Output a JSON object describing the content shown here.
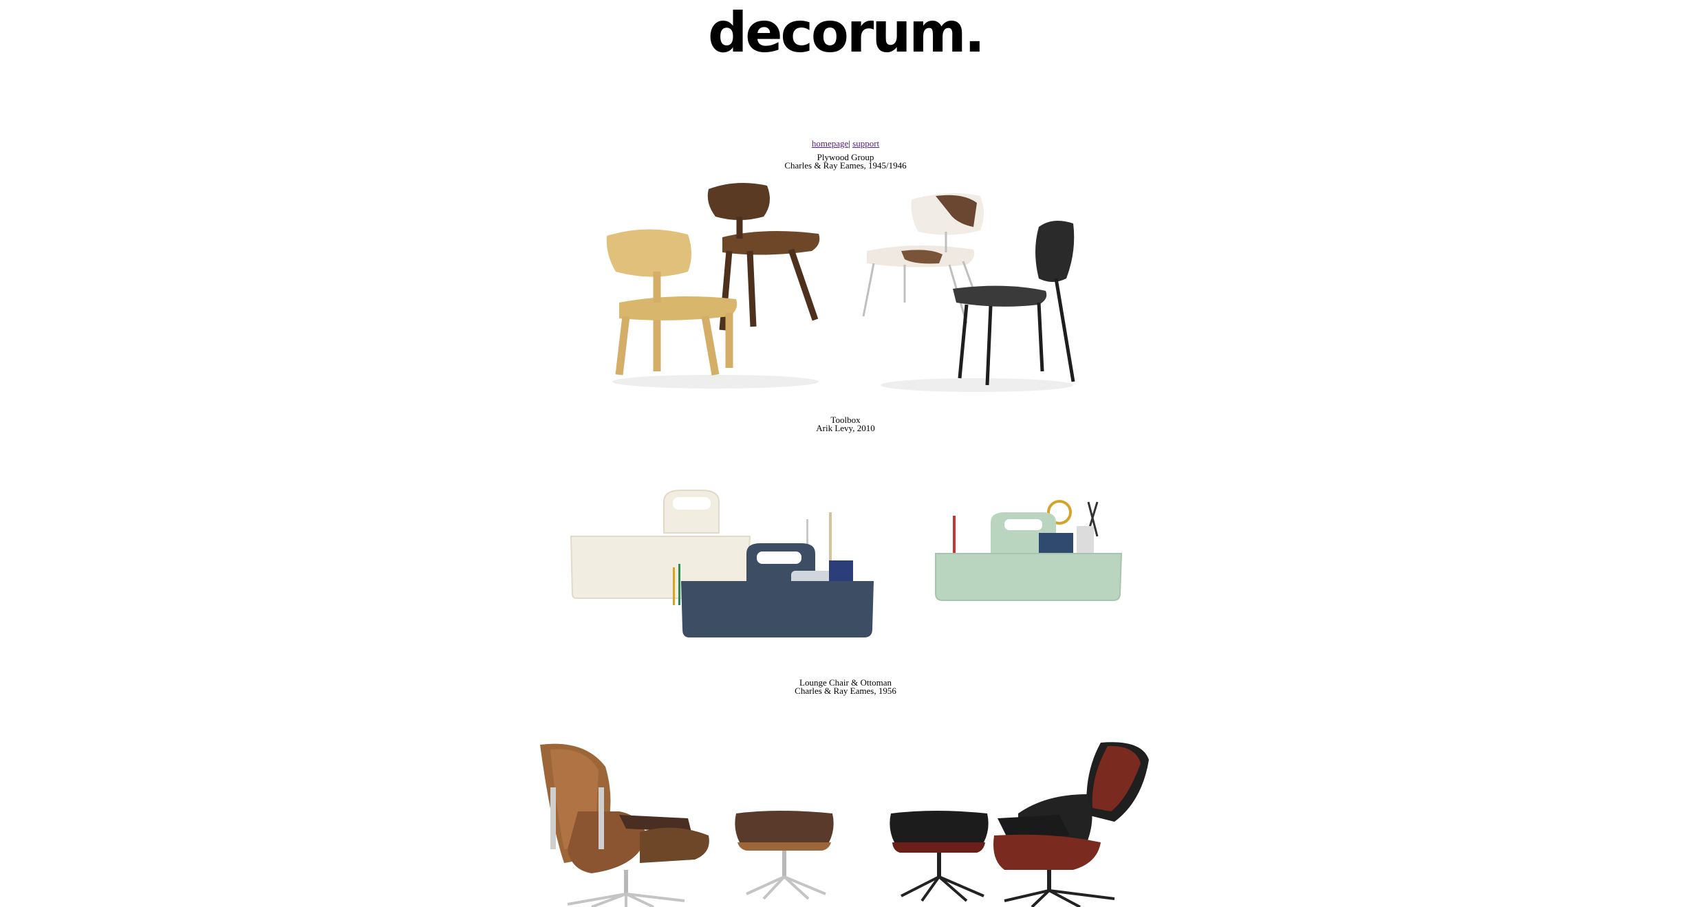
{
  "site": {
    "logo": "decorum."
  },
  "nav": {
    "home": "homepage",
    "separator": "|",
    "support": "support"
  },
  "sections": [
    {
      "title": "Plywood Group",
      "subtitle": "Charles & Ray Eames, 1945/1946"
    },
    {
      "title": "Toolbox",
      "subtitle": "Arik Levy, 2010"
    },
    {
      "title": "Lounge Chair & Ottoman",
      "subtitle": "Charles & Ray Eames, 1956"
    }
  ],
  "colors": {
    "birch": "#e0c07a",
    "walnut": "#5a3a22",
    "navy": "#3d4d63",
    "mint": "#b9d4bf",
    "cream": "#f1ede0",
    "rosewood": "#6b1f18"
  }
}
